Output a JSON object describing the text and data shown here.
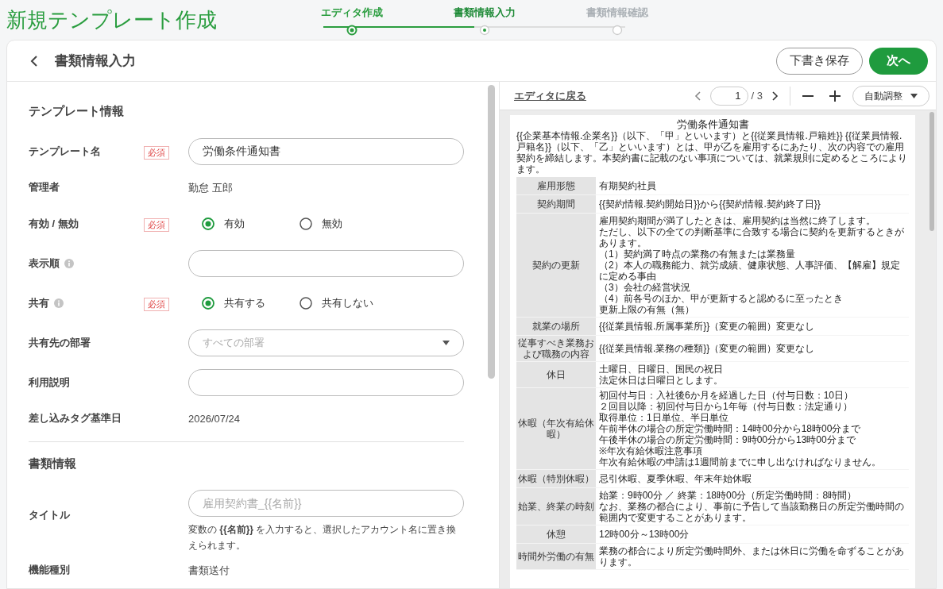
{
  "app_title": "新規テンプレート作成",
  "steps": [
    {
      "label": "エディタ作成",
      "done": true,
      "selected": false
    },
    {
      "label": "書類情報入力",
      "done": false,
      "selected": true
    },
    {
      "label": "書類情報確認",
      "done": false,
      "selected": false
    }
  ],
  "header": {
    "title": "書類情報入力",
    "buttons": [
      {
        "label": "下書き保存",
        "kind": "outline"
      },
      {
        "label": "次へ",
        "kind": "primary"
      }
    ]
  },
  "sections": [
    {
      "title": "テンプレート情報",
      "fields": [
        {
          "label": "テンプレート名",
          "required_badge": "必須",
          "kind": "input",
          "value": "労働条件通知書"
        },
        {
          "label": "管理者",
          "kind": "text",
          "value": "勤怠 五郎"
        },
        {
          "label": "有効 / 無効",
          "required_badge": "必須",
          "kind": "radio",
          "options": [
            {
              "label": "有効",
              "selected": true
            },
            {
              "label": "無効",
              "selected": false
            }
          ]
        },
        {
          "label": "表示順",
          "info": true,
          "kind": "input"
        },
        {
          "label": "共有",
          "required_badge": "必須",
          "info": true,
          "kind": "radio",
          "options": [
            {
              "label": "共有する",
              "selected": true
            },
            {
              "label": "共有しない",
              "selected": false
            }
          ]
        },
        {
          "label": "共有先の部署",
          "kind": "select",
          "placeholder": "すべての部署"
        },
        {
          "label": "利用説明",
          "kind": "input"
        },
        {
          "label": "差し込みタグ基準日",
          "kind": "text",
          "value": "2026/07/24"
        }
      ]
    },
    {
      "title": "書類情報",
      "fields": [
        {
          "label": "タイトル",
          "kind": "input",
          "placeholder": "雇用契約書_{{名前}}",
          "help": "変数の **{{名前}}** を入力すると、選択したアカウント名に置き換えられます。"
        },
        {
          "label": "機能種別",
          "kind": "text",
          "value": "書類送付"
        }
      ]
    }
  ],
  "preview": {
    "back_link": "エディタに戻る",
    "page": "1",
    "page_total": "/ 3",
    "zoom": "自動調整",
    "document": {
      "title": "労働条件通知書",
      "intro": "{{企業基本情報.企業名}}（以下、「甲」といいます）と{{従業員情報.戸籍姓}} {{従業員情報.戸籍名}}（以下、「乙」といいます）とは、甲が乙を雇用するにあたり、次の内容での雇用契約を締結します。本契約書に記載のない事項については、就業規則に定めるところによります。",
      "rows": [
        {
          "label": "雇用形態",
          "lines": [
            "有期契約社員"
          ]
        },
        {
          "label": "契約期間",
          "lines": [
            "{{契約情報.契約開始日}}から{{契約情報.契約終了日}}"
          ]
        },
        {
          "label": "契約の更新",
          "lines": [
            "雇用契約期間が満了したときは、雇用契約は当然に終了します。",
            "ただし、以下の全ての判断基準に合致する場合に契約を更新するときがあります。",
            "（1）契約満了時点の業務の有無または業務量",
            "（2）本人の職務能力、就労成績、健康状態、人事評価、【解雇】規定に定める事由",
            "（3）会社の経営状況",
            "（4）前各号のほか、甲が更新すると認めるに至ったとき",
            "更新上限の有無（無）"
          ]
        },
        {
          "label": "就業の場所",
          "lines": [
            "{{従業員情報.所属事業所}}（変更の範囲）変更なし"
          ]
        },
        {
          "label": "従事すべき業務および職務の内容",
          "lines": [
            "{{従業員情報.業務の種類}}（変更の範囲）変更なし"
          ]
        },
        {
          "label": "休日",
          "lines": [
            "土曜日、日曜日、国民の祝日",
            "法定休日は日曜日とします。"
          ]
        },
        {
          "label": "休暇（年次有給休暇）",
          "lines": [
            "初回付与日：入社後6か月を経過した日（付与日数：10日）",
            "２回目以降：初回付与日から1年毎（付与日数：法定通り）",
            "取得単位：1日単位、半日単位",
            "午前半休の場合の所定労働時間：14時00分から18時00分まで",
            "午後半休の場合の所定労働時間：9時00分から13時00分まで",
            "※年次有給休暇注意事項",
            "年次有給休暇の申請は1週間前までに申し出なければなりません。"
          ]
        },
        {
          "label": "休暇（特別休暇）",
          "lines": [
            "忌引休暇、夏季休暇、年末年始休暇"
          ]
        },
        {
          "label": "始業、終業の時刻",
          "lines": [
            "始業：9時00分 ／ 終業：18時00分（所定労働時間：8時間）",
            "なお、業務の都合により、事前に予告して当該勤務日の所定労働時間の範囲内で変更することがあります。"
          ]
        },
        {
          "label": "休憩",
          "lines": [
            "12時00分～13時00分"
          ]
        },
        {
          "label": "時間外労働の有無",
          "lines": [
            "業務の都合により所定労働時間外、または休日に労働を命ずることがあります。"
          ]
        }
      ]
    }
  }
}
